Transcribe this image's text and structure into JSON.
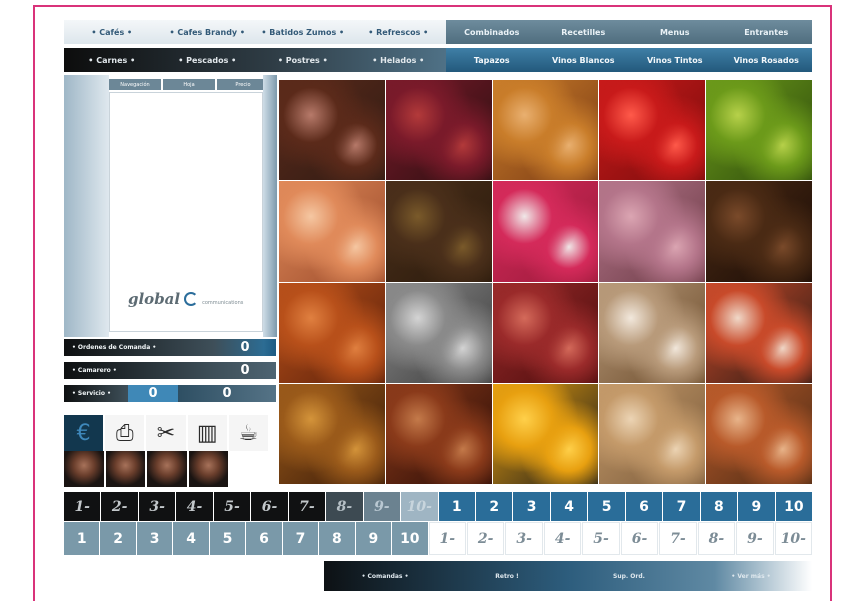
{
  "top_menu_light": [
    "• Cafés •",
    "• Cafes Brandy •",
    "• Batidos Zumos •",
    "• Refrescos •"
  ],
  "top_menu_dark": [
    "Combinados",
    "Recetilles",
    "Menus",
    "Entrantes"
  ],
  "second_menu_dark": [
    "• Carnes •",
    "• Pescados •",
    "• Postres •",
    "• Helados •"
  ],
  "second_menu_blue": [
    "Tapazos",
    "Vinos Blancos",
    "Vinos Tintos",
    "Vinos Rosados"
  ],
  "panel_tabs": [
    "Navegación",
    "Hoja",
    "Precio"
  ],
  "logo": {
    "word": "global",
    "sub": "communications"
  },
  "counters": {
    "row1": {
      "label": "• Ordenes de Comanda •",
      "value": "0"
    },
    "row2": {
      "label": "• Camarero •",
      "value": "0"
    },
    "row3": {
      "label": "• Servicio •",
      "mid": "0",
      "value": "0"
    }
  },
  "icons": [
    "euro-icon",
    "printer-icon",
    "scissors-icon",
    "register-icon",
    "coffee-machine-icon"
  ],
  "photos": [
    {
      "name": "cupcakes",
      "colors": [
        "#5b2a1a",
        "#b77a6a",
        "#2f1b14"
      ]
    },
    {
      "name": "jam-jar",
      "colors": [
        "#7a1a2a",
        "#b33a3a",
        "#2a0f10"
      ]
    },
    {
      "name": "tea-glass",
      "colors": [
        "#c97d2a",
        "#e9b070",
        "#7a3a14"
      ]
    },
    {
      "name": "strawberries",
      "colors": [
        "#c81a1a",
        "#ff5a4a",
        "#7a0c0c"
      ]
    },
    {
      "name": "limes",
      "colors": [
        "#6c9a1a",
        "#b7d14a",
        "#2d4a0c"
      ]
    },
    {
      "name": "salmon",
      "colors": [
        "#e08a5a",
        "#f5c7a2",
        "#9a4a2a"
      ]
    },
    {
      "name": "vegetables",
      "colors": [
        "#4a2f1a",
        "#7a5a2a",
        "#2a1a0c"
      ]
    },
    {
      "name": "dragonfruit",
      "colors": [
        "#d42a5a",
        "#f0e8e8",
        "#9a1a3a"
      ]
    },
    {
      "name": "onions",
      "colors": [
        "#b4758a",
        "#dba5b2",
        "#6a3a44"
      ]
    },
    {
      "name": "truffles",
      "colors": [
        "#4a2a14",
        "#7a4a2a",
        "#1a0c06"
      ]
    },
    {
      "name": "shrimp",
      "colors": [
        "#b8501a",
        "#e08040",
        "#5a200a"
      ]
    },
    {
      "name": "oysters",
      "colors": [
        "#8a8a8a",
        "#d4d4d4",
        "#3a3a3a"
      ]
    },
    {
      "name": "lychees",
      "colors": [
        "#9a2a2a",
        "#d46a5a",
        "#4a0c0c"
      ]
    },
    {
      "name": "coconut",
      "colors": [
        "#b89a7a",
        "#f2e8dc",
        "#6a4a2a"
      ]
    },
    {
      "name": "sushi",
      "colors": [
        "#c84a2a",
        "#f0d8c8",
        "#2a1a14"
      ]
    },
    {
      "name": "fried-dish",
      "colors": [
        "#9a5a1a",
        "#d4943a",
        "#3a1a08"
      ]
    },
    {
      "name": "drink",
      "colors": [
        "#8a3a1a",
        "#c47a4a",
        "#2a0c06"
      ]
    },
    {
      "name": "papaya",
      "colors": [
        "#e8a010",
        "#ffd04a",
        "#1a1a1a"
      ]
    },
    {
      "name": "almonds",
      "colors": [
        "#c49a6a",
        "#ecd4b4",
        "#7a5a3a"
      ]
    },
    {
      "name": "skewers",
      "colors": [
        "#b85a2a",
        "#e8b48a",
        "#4a2a14"
      ]
    }
  ],
  "numbers_row1": [
    "1-",
    "2-",
    "3-",
    "4-",
    "5-",
    "6-",
    "7-",
    "8-",
    "9-",
    "10-",
    "1",
    "2",
    "3",
    "4",
    "5",
    "6",
    "7",
    "8",
    "9",
    "10"
  ],
  "numbers_row2": [
    "1",
    "2",
    "3",
    "4",
    "5",
    "6",
    "7",
    "8",
    "9",
    "10",
    "1-",
    "2-",
    "3-",
    "4-",
    "5-",
    "6-",
    "7-",
    "8-",
    "9-",
    "10-"
  ],
  "bottom_menu": [
    "• Comandas •",
    "Retro !",
    "Sup. Ord.",
    "• Ver más •"
  ]
}
